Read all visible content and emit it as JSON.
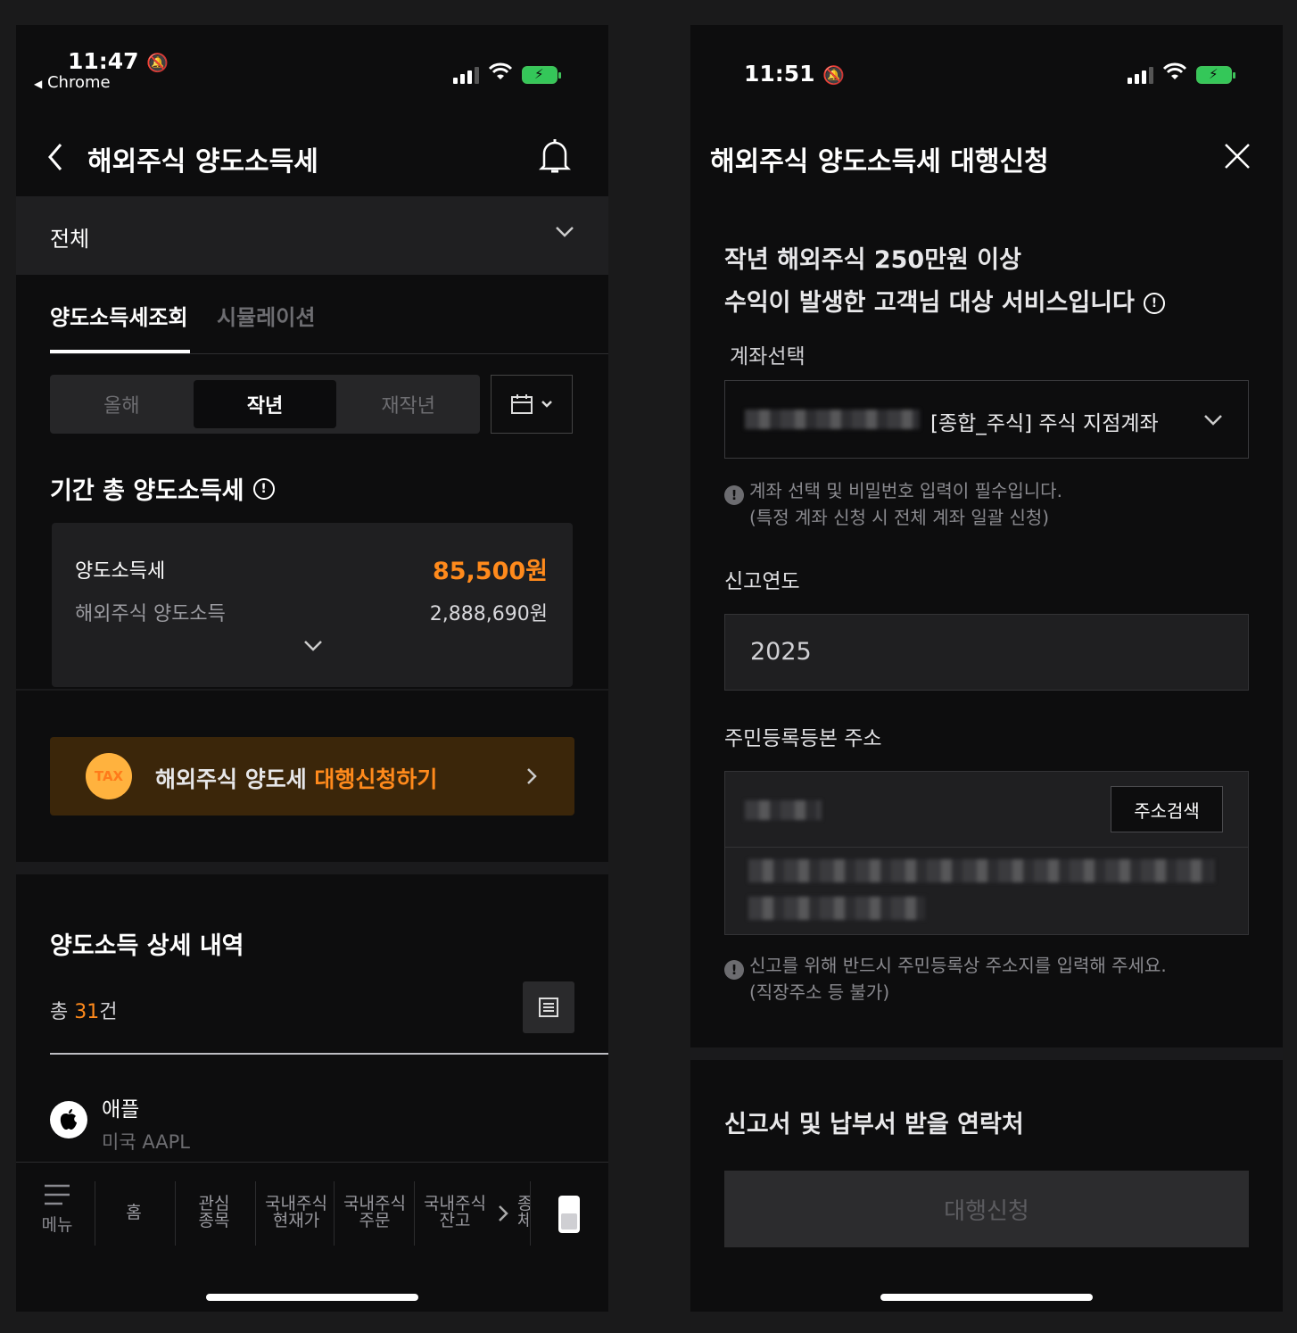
{
  "left": {
    "status": {
      "time": "11:47",
      "back_app": "Chrome"
    },
    "header": {
      "title": "해외주식 양도소득세"
    },
    "filter": {
      "value": "전체"
    },
    "tabs": [
      {
        "label": "양도소득세조회"
      },
      {
        "label": "시뮬레이션"
      }
    ],
    "period": {
      "options": [
        "올해",
        "작년",
        "재작년"
      ],
      "selected": "작년"
    },
    "summary": {
      "heading": "기간 총 양도소득세",
      "tax_label": "양도소득세",
      "tax_value": "85,500원",
      "income_label": "해외주식 양도소득",
      "income_value": "2,888,690원"
    },
    "banner": {
      "badge": "TAX",
      "text": "해외주식 양도세 ",
      "highlight": "대행신청하기"
    },
    "detail": {
      "heading": "양도소득 상세 내역",
      "count_prefix": "총 ",
      "count": "31",
      "count_suffix": "건",
      "items": [
        {
          "name": "애플",
          "sub": "미국 AAPL"
        }
      ]
    },
    "bottom_nav": {
      "menu": "메뉴",
      "items": [
        {
          "l1": "홈",
          "l2": ""
        },
        {
          "l1": "관심",
          "l2": "종목"
        },
        {
          "l1": "국내주식",
          "l2": "현재가"
        },
        {
          "l1": "국내주식",
          "l2": "주문"
        },
        {
          "l1": "국내주식",
          "l2": "잔고"
        }
      ],
      "partial": "종\n체"
    }
  },
  "right": {
    "status": {
      "time": "11:51"
    },
    "header": {
      "title": "해외주식 양도소득세 대행신청"
    },
    "intro": {
      "line1": "작년 해외주식 250만원 이상",
      "line2": "수익이 발생한 고객님 대상 서비스입니다"
    },
    "account": {
      "label": "계좌선택",
      "value": "[종합_주식] 주식 지점계좌",
      "note1": "계좌 선택 및 비밀번호 입력이 필수입니다.",
      "note2": "(특정 계좌 신청 시 전체 계좌 일괄 신청)"
    },
    "year": {
      "label": "신고연도",
      "value": "2025"
    },
    "address": {
      "label": "주민등록등본 주소",
      "search_button": "주소검색",
      "note1": "신고를 위해 반드시 주민등록상 주소지를 입력해 주세요.",
      "note2": "(직장주소 등 불가)"
    },
    "contact": {
      "heading": "신고서 및 납부서 받을 연락처"
    },
    "submit": {
      "label": "대행신청"
    }
  },
  "colors": {
    "accent": "#ff8a1c",
    "banner_bg": "#3b260a",
    "battery": "#34c759"
  }
}
